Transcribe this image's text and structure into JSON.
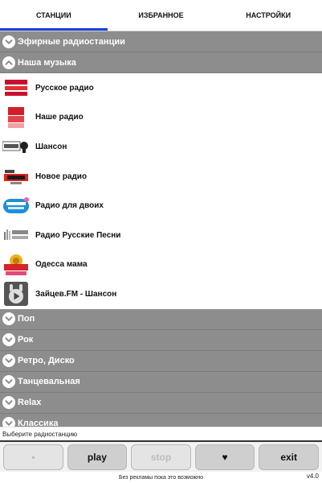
{
  "tabs": [
    {
      "label": "СТАНЦИИ",
      "active": true
    },
    {
      "label": "ИЗБРАННОЕ",
      "active": false
    },
    {
      "label": "НАСТРОЙКИ",
      "active": false
    }
  ],
  "categories_top": [
    {
      "label": "Эфирные радиостанции",
      "expanded": false,
      "icon": "chevron-down-icon"
    },
    {
      "label": "Наша музыка",
      "expanded": true,
      "icon": "chevron-up-icon"
    }
  ],
  "stations": [
    {
      "name": "Русское радио",
      "logo": "russkoe-radio-logo"
    },
    {
      "name": "Наше радио",
      "logo": "nashe-radio-logo"
    },
    {
      "name": "Шансон",
      "logo": "shanson-logo"
    },
    {
      "name": "Новое радио",
      "logo": "novoe-radio-logo"
    },
    {
      "name": "Радио для двоих",
      "logo": "radio-dlya-dvoih-logo"
    },
    {
      "name": "Радио Русские Песни",
      "logo": "russkie-pesni-logo"
    },
    {
      "name": "Одесса мама",
      "logo": "odessa-mama-logo"
    },
    {
      "name": "Зайцев.FM - Шансон",
      "logo": "zaycev-fm-logo"
    }
  ],
  "categories_bottom": [
    {
      "label": "Поп",
      "icon": "chevron-down-icon"
    },
    {
      "label": "Рок",
      "icon": "chevron-down-icon"
    },
    {
      "label": "Ретро, Диско",
      "icon": "chevron-down-icon"
    },
    {
      "label": "Танцевальная",
      "icon": "chevron-down-icon"
    },
    {
      "label": "Relax",
      "icon": "chevron-down-icon"
    },
    {
      "label": "Классика",
      "icon": "chevron-down-icon"
    }
  ],
  "status": {
    "text": "Выберите радиостанцию"
  },
  "controls": {
    "dot": "•",
    "play": "play",
    "stop": "stop",
    "fav": "♥",
    "exit": "exit"
  },
  "footer": {
    "text": "Без рекламы пока это возможно",
    "version": "v4.0"
  },
  "colors": {
    "category_bg": "#8d8d8d",
    "tab_indicator": "#1a3fd8",
    "button_bg": "#cfcfcf"
  }
}
